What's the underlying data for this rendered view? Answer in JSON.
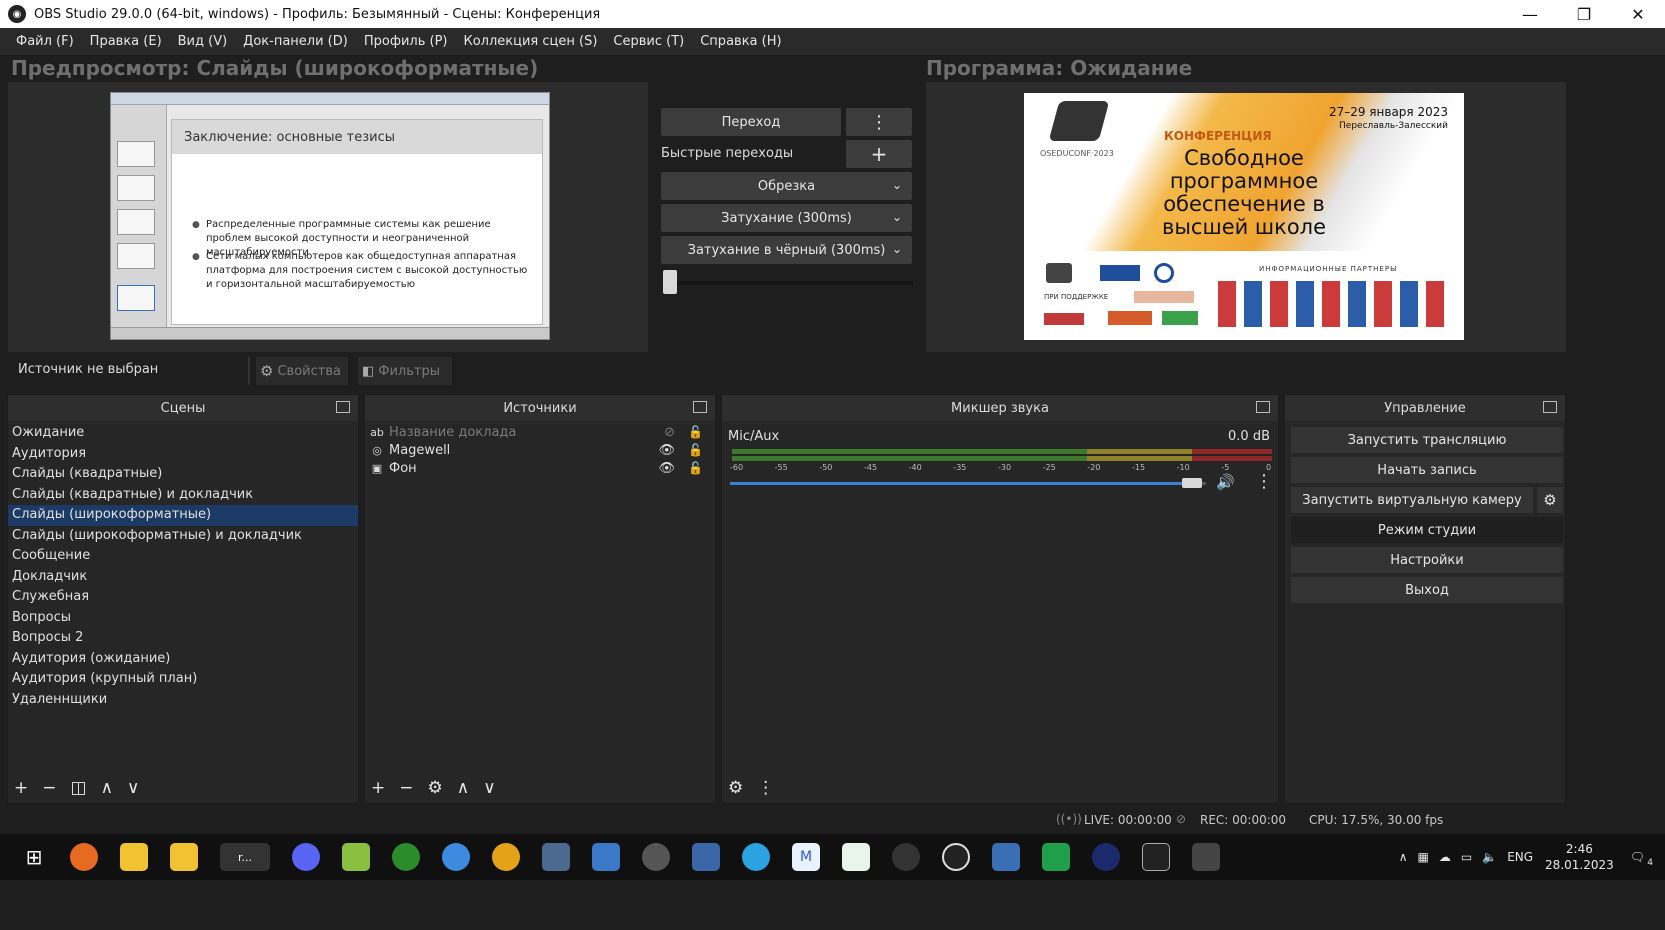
{
  "window": {
    "title": "OBS Studio 29.0.0 (64-bit, windows) - Профиль: Безымянный - Сцены: Конференция",
    "logo_glyph": "◉",
    "minimize": "—",
    "maximize": "❐",
    "close": "✕"
  },
  "menu": [
    "Файл (F)",
    "Правка (E)",
    "Вид (V)",
    "Док-панели (D)",
    "Профиль (P)",
    "Коллекция сцен (S)",
    "Сервис (T)",
    "Справка (H)"
  ],
  "preview": {
    "title": "Предпросмотр: Слайды (широкоформатные)",
    "slide_heading": "Заключение: основные тезисы",
    "bullet1": "Распределенные программные системы как решение проблем высокой доступности и неограниченной масштабируемости",
    "bullet2": "Сети малых компьютеров как общедоступная аппаратная платформа для построения систем с высокой доступностью и горизонтальной масштабируемостью"
  },
  "transitions": {
    "transition_label": "Переход",
    "quick_label": "Быстрые переходы",
    "items": [
      "Обрезка",
      "Затухание (300ms)",
      "Затухание в чёрный (300ms)"
    ],
    "menu_glyph": "⋮",
    "add_glyph": "+",
    "chevron_glyph": "⌄"
  },
  "program": {
    "title": "Программа: Ожидание",
    "dates": "27–29 января 2023",
    "city": "Переславль-Залесский",
    "conf_label": "КОНФЕРЕНЦИЯ",
    "headline": "Свободное программное обеспечение в высшей школе",
    "brand": "OSEDUCONF·2023",
    "partners_title": "ИНФОРМАЦИОННЫЕ ПАРТНЕРЫ",
    "sponsor_label": "ПРИ ПОДДЕРЖКЕ"
  },
  "source_bar": {
    "no_source": "Источник не выбран",
    "properties": "Свойства",
    "filters": "Фильтры",
    "gear_glyph": "⚙",
    "filter_glyph": "◧"
  },
  "scenes": {
    "header": "Сцены",
    "items": [
      "Ожидание",
      "Аудитория",
      "Слайды (квадратные)",
      "Слайды (квадратные) и докладчик",
      "Слайды (широкоформатные)",
      "Слайды (широкоформатные) и докладчик",
      "Сообщение",
      "Докладчик",
      "Служебная",
      "Вопросы",
      "Вопросы 2",
      "Аудитория (ожидание)",
      "Аудитория (крупный план)",
      "Удаленнщики"
    ],
    "selected_index": 4
  },
  "sources": {
    "header": "Источники",
    "items": [
      {
        "name": "Название доклада",
        "icon": "ab",
        "visible": false
      },
      {
        "name": "Magewell",
        "icon": "◎",
        "visible": true
      },
      {
        "name": "Фон",
        "icon": "▣",
        "visible": true
      }
    ],
    "eye_on": "👁",
    "eye_off": "⊘",
    "lock_glyph": "🔓"
  },
  "mixer": {
    "header": "Микшер звука",
    "channel": "Mic/Aux",
    "level": "0.0 dB",
    "ticks": [
      "-60",
      "-55",
      "-50",
      "-45",
      "-40",
      "-35",
      "-30",
      "-25",
      "-20",
      "-15",
      "-10",
      "-5",
      "0"
    ],
    "volume_fraction": 0.98,
    "speaker_glyph": "🔊",
    "menu_glyph": "⋮",
    "gear_glyph": "⚙"
  },
  "controls": {
    "header": "Управление",
    "start_stream": "Запустить трансляцию",
    "start_record": "Начать запись",
    "virtual_cam": "Запустить виртуальную камеру",
    "studio_mode": "Режим студии",
    "settings": "Настройки",
    "exit": "Выход",
    "gear_glyph": "⚙"
  },
  "footer_buttons": {
    "add": "+",
    "remove": "−",
    "filter": "◫",
    "up": "∧",
    "down": "∨",
    "gear": "⚙"
  },
  "status": {
    "live": "LIVE: 00:00:00",
    "rec": "REC: 00:00:00",
    "cpu": "CPU: 17.5%, 30.00 fps"
  },
  "taskbar": {
    "lang": "ENG",
    "time": "2:46",
    "date": "28.01.2023",
    "notif_count": "4",
    "terminal_label": "r..."
  },
  "colors": {
    "accent_selected": "#1c3a66",
    "meter_green": "#4a9a3a",
    "meter_yellow": "#b9a634",
    "meter_red": "#b83232",
    "volume_blue": "#3a83d6",
    "program_orange": "#f0a430"
  }
}
